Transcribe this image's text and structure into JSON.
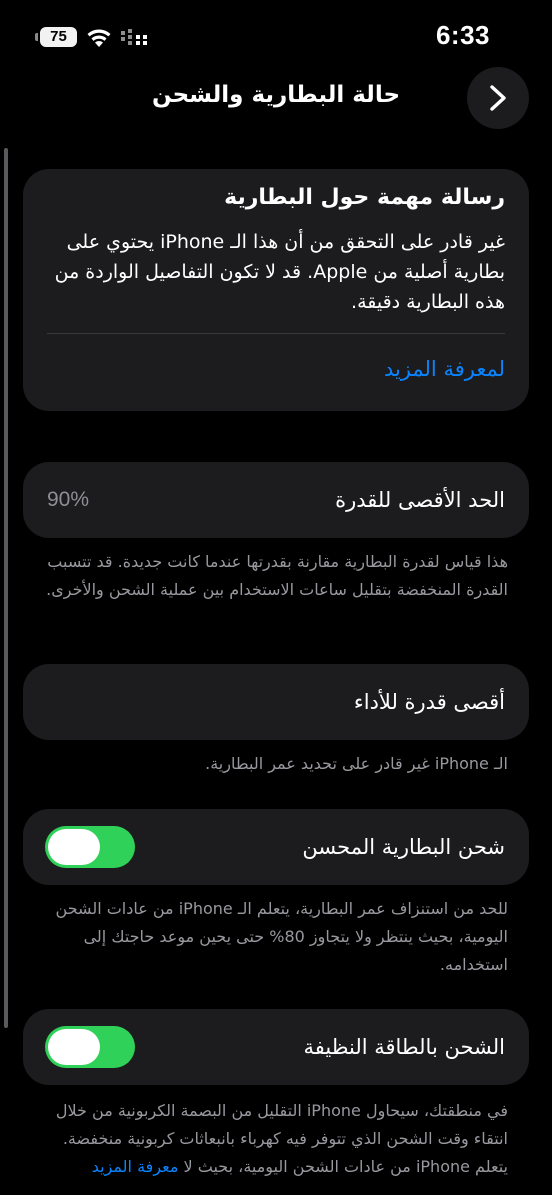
{
  "status_bar": {
    "time": "6:33",
    "battery_level": "75",
    "icons": [
      "wifi-icon",
      "cellular-signal-icon"
    ]
  },
  "nav": {
    "title": "حالة البطارية والشحن",
    "back_icon": "chevron-right-icon"
  },
  "important_message": {
    "title": "رسالة مهمة حول البطارية",
    "body": "غير قادر على التحقق من أن هذا الـ iPhone يحتوي على بطارية أصلية من Apple. قد لا تكون التفاصيل الواردة من هذه البطارية دقيقة.",
    "learn_more": "لمعرفة المزيد"
  },
  "maximum_capacity": {
    "label": "الحد الأقصى للقدرة",
    "value": "90%",
    "footnote": "هذا قياس لقدرة البطارية مقارنة بقدرتها عندما كانت جديدة. قد تتسبب القدرة المنخفضة بتقليل ساعات الاستخدام بين عملية الشحن والأخرى."
  },
  "peak_performance": {
    "label": "أقصى قدرة للأداء",
    "footnote": "الـ iPhone غير قادر على تحديد عمر البطارية."
  },
  "optimized_charging": {
    "label": "شحن البطارية المحسن",
    "enabled": true,
    "footnote": "للحد من استنزاف عمر البطارية، يتعلم الـ iPhone من عادات الشحن اليومية، بحيث ينتظر ولا يتجاوز 80% حتى يحين موعد حاجتك إلى استخدامه."
  },
  "clean_energy_charging": {
    "label": "الشحن بالطاقة النظيفة",
    "enabled": true,
    "footnote": "في منطقتك، سيحاول iPhone التقليل من البصمة الكربونية من خلال انتقاء وقت الشحن الذي تتوفر فيه كهرباء بانبعاثات كربونية منخفضة. يتعلم iPhone من عادات الشحن اليومية، بحيث لا",
    "footnote_link": "معرفة المزيد"
  },
  "colors": {
    "background": "#000000",
    "card": "#1c1c1e",
    "accent_blue": "#0a84ff",
    "toggle_on": "#30d158",
    "secondary_text": "#98989f"
  }
}
